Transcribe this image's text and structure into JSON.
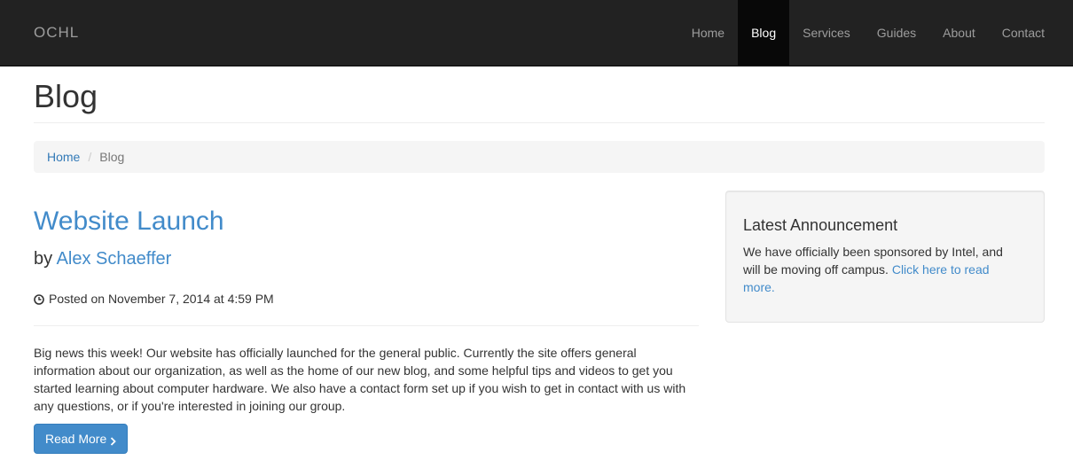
{
  "navbar": {
    "brand": "OCHL",
    "items": [
      {
        "label": "Home",
        "active": false
      },
      {
        "label": "Blog",
        "active": true
      },
      {
        "label": "Services",
        "active": false
      },
      {
        "label": "Guides",
        "active": false
      },
      {
        "label": "About",
        "active": false
      },
      {
        "label": "Contact",
        "active": false
      }
    ]
  },
  "page": {
    "title": "Blog"
  },
  "breadcrumb": {
    "home": "Home",
    "separator": "/",
    "current": "Blog"
  },
  "post": {
    "title": "Website Launch",
    "by": "by",
    "author": "Alex Schaeffer",
    "clock_icon": "clock-icon",
    "date": "Posted on November 7, 2014 at 4:59 PM",
    "body": "Big news this week! Our website has officially launched for the general public. Currently the site offers general information about our organization, as well as the home of our new blog, and some helpful tips and videos to get you started learning about computer hardware. We also have a contact form set up if you wish to get in contact with us with any questions, or if you're interested in joining our group.",
    "read_more": "Read More"
  },
  "sidebar": {
    "title": "Latest Announcement",
    "text": "We have officially been sponsored by Intel, and will be moving off campus.",
    "link": "Click here to read more."
  },
  "colors": {
    "navbar_bg": "#222222",
    "active_bg": "#080808",
    "link": "#428bca",
    "button": "#428bca"
  }
}
